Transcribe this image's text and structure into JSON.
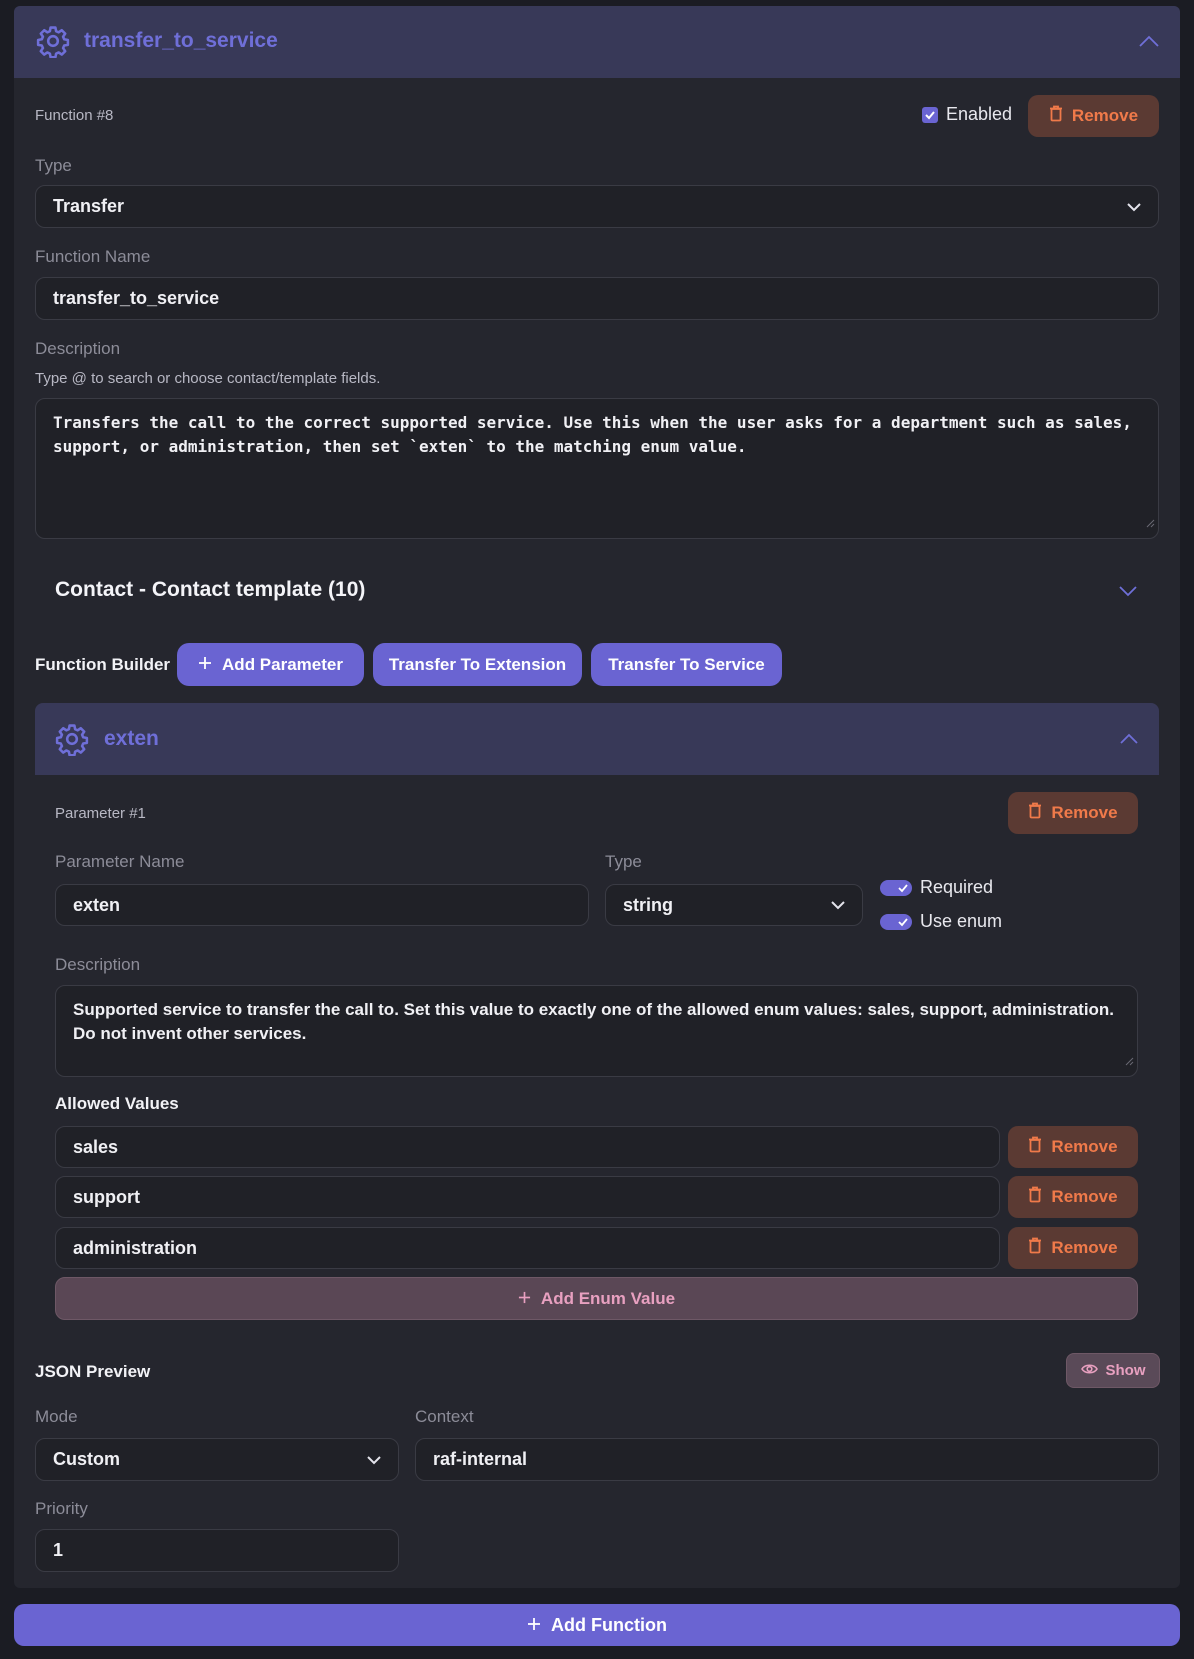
{
  "function": {
    "title": "transfer_to_service",
    "number_label": "Function #8",
    "enabled_label": "Enabled",
    "enabled": true,
    "remove_label": "Remove",
    "type_label": "Type",
    "type_value": "Transfer",
    "name_label": "Function Name",
    "name_value": "transfer_to_service",
    "description_label": "Description",
    "description_hint": "Type @ to search or choose contact/template fields.",
    "description_value": "Transfers the call to the correct supported service. Use this when the user asks for a department such as sales, support, or administration, then set `exten` to the matching enum value."
  },
  "contact_section": {
    "title": "Contact - Contact template (10)"
  },
  "builder": {
    "label": "Function Builder",
    "add_parameter": "Add Parameter",
    "transfer_extension": "Transfer To Extension",
    "transfer_service": "Transfer To Service"
  },
  "parameter": {
    "title": "exten",
    "number_label": "Parameter #1",
    "remove_label": "Remove",
    "name_label": "Parameter Name",
    "name_value": "exten",
    "type_label": "Type",
    "type_value": "string",
    "required_label": "Required",
    "required": true,
    "use_enum_label": "Use enum",
    "use_enum": true,
    "description_label": "Description",
    "description_value": "Supported service to transfer the call to. Set this value to exactly one of the allowed enum values: sales, support, administration. Do not invent other services.",
    "allowed_values_label": "Allowed Values",
    "allowed_values": [
      {
        "value": "sales",
        "remove_label": "Remove"
      },
      {
        "value": "support",
        "remove_label": "Remove"
      },
      {
        "value": "administration",
        "remove_label": "Remove"
      }
    ],
    "add_enum_label": "Add Enum Value"
  },
  "json_preview": {
    "label": "JSON Preview",
    "show_label": "Show"
  },
  "settings": {
    "mode_label": "Mode",
    "mode_value": "Custom",
    "context_label": "Context",
    "context_value": "raf-internal",
    "priority_label": "Priority",
    "priority_value": "1"
  },
  "footer": {
    "add_function_label": "Add Function"
  },
  "colors": {
    "background": "#1b1c23",
    "card": "#25262e",
    "header": "#383958",
    "accent": "#6a64d2",
    "danger_bg": "#5b3a33",
    "danger_text": "#f07a4a"
  },
  "icons": [
    "gear-icon",
    "chevron-up-icon",
    "chevron-down-icon",
    "checkbox-icon",
    "trash-icon",
    "plus-icon",
    "eye-icon",
    "resize-handle-icon"
  ]
}
